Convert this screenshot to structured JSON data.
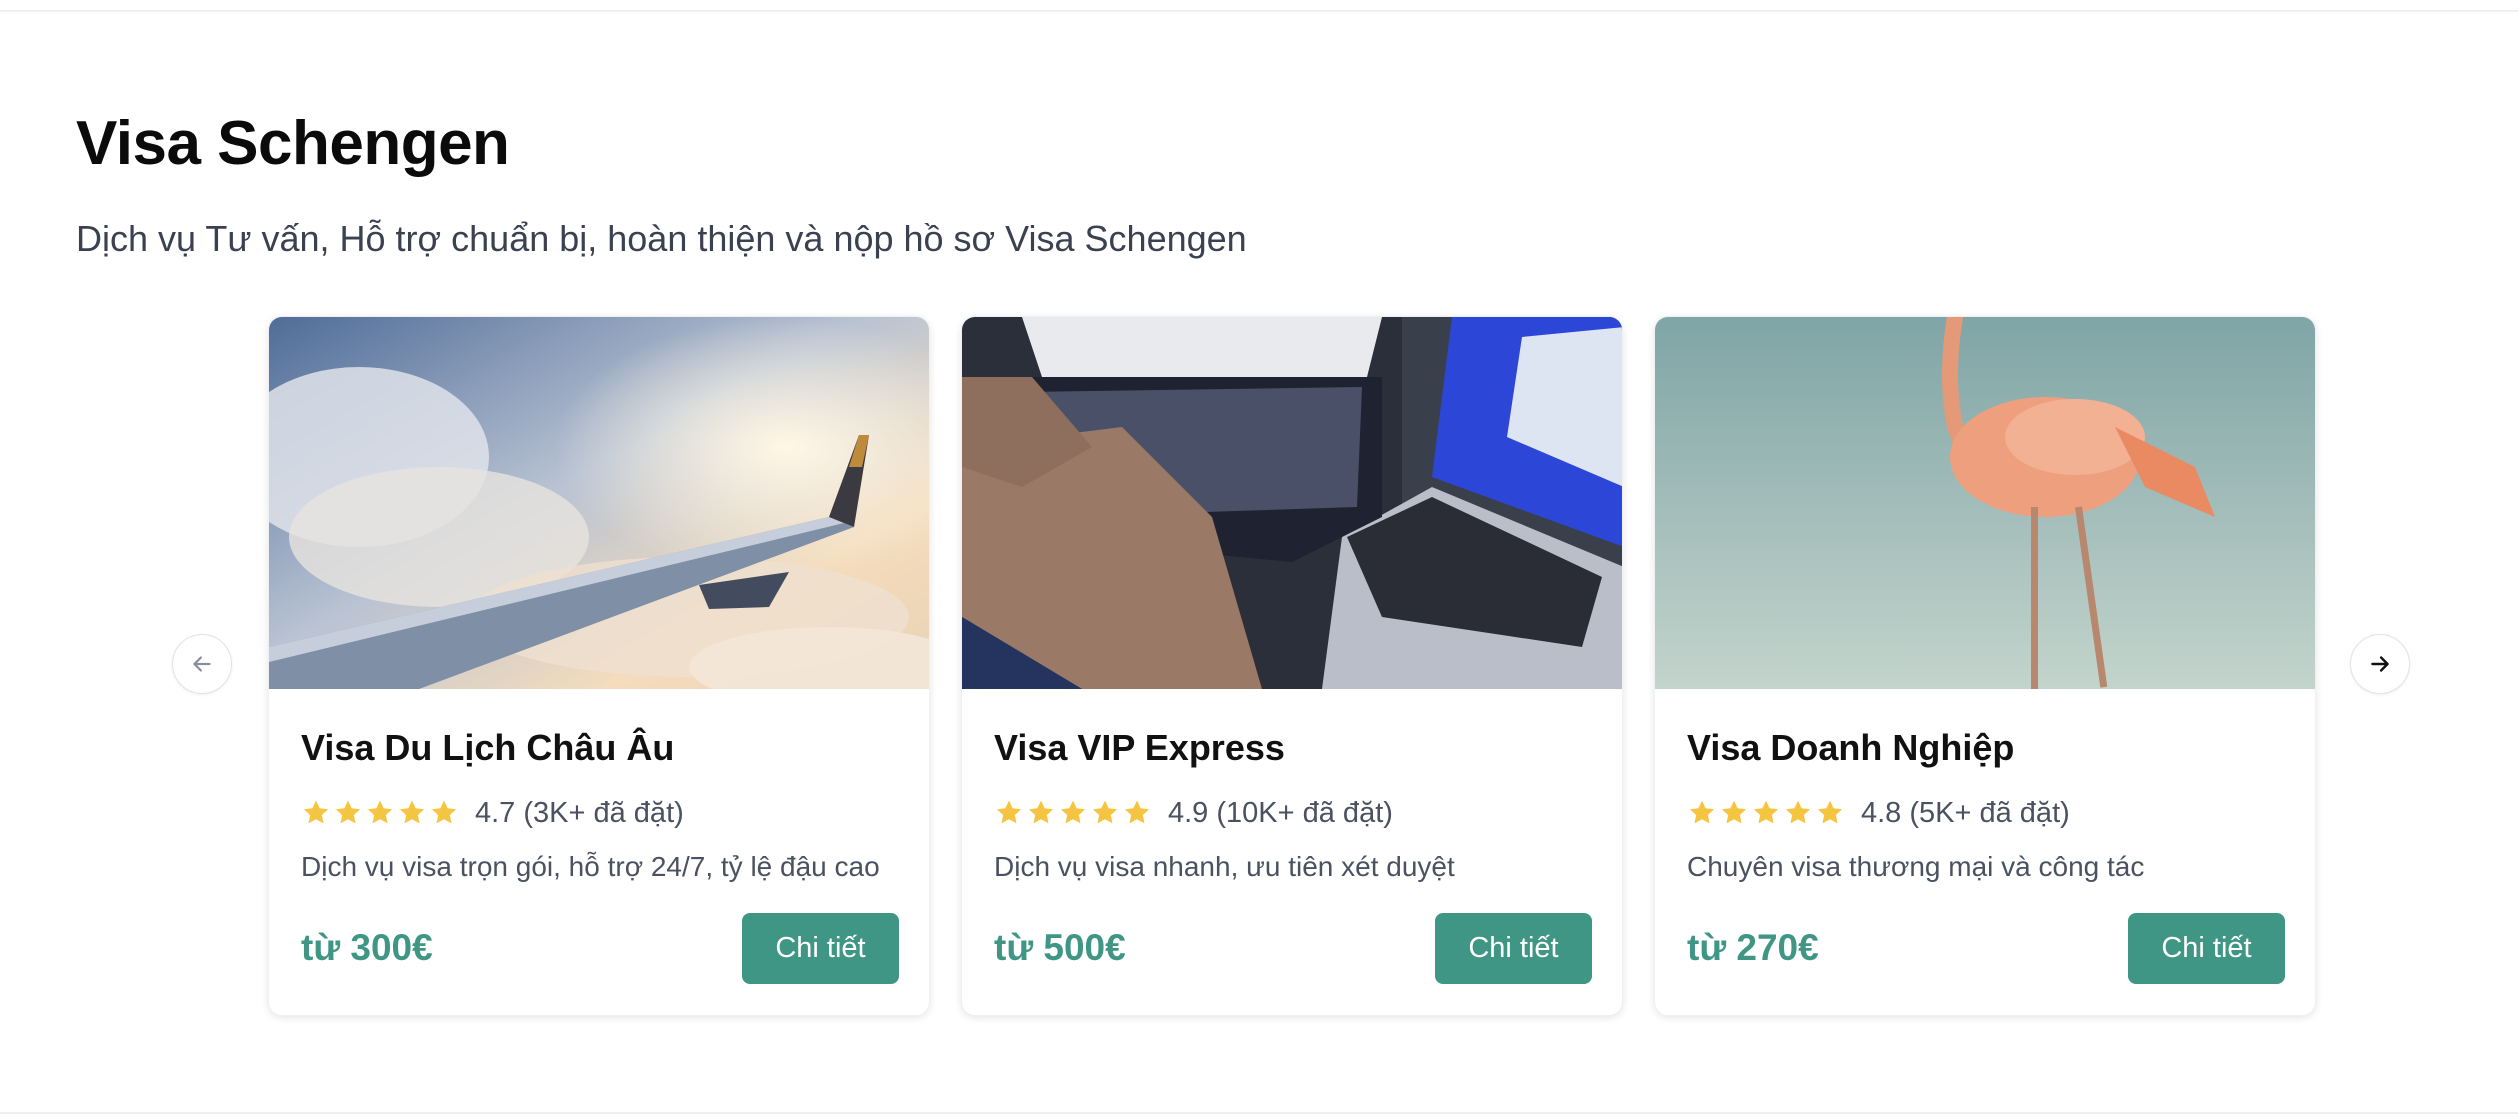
{
  "section": {
    "title": "Visa Schengen",
    "subtitle": "Dịch vụ Tư vấn, Hỗ trợ chuẩn bị, hoàn thiện và nộp hồ sơ Visa Schengen"
  },
  "carousel": {
    "prev_icon": "arrow-left-icon",
    "next_icon": "arrow-right-icon"
  },
  "colors": {
    "accent": "#3f9684",
    "star": "#f5c542",
    "title": "#0b0b0b",
    "muted": "#4a5160"
  },
  "cards": [
    {
      "title": "Visa Du Lịch Châu Âu",
      "stars": 5,
      "rating": "4.7 (3K+ đã đặt)",
      "description": "Dịch vụ visa trọn gói, hỗ trợ 24/7, tỷ lệ đậu cao",
      "price": "từ 300€",
      "button": "Chi tiết"
    },
    {
      "title": "Visa VIP Express",
      "stars": 5,
      "rating": "4.9 (10K+ đã đặt)",
      "description": "Dịch vụ visa nhanh, ưu tiên xét duyệt",
      "price": "từ 500€",
      "button": "Chi tiết"
    },
    {
      "title": "Visa Doanh Nghiệp",
      "stars": 5,
      "rating": "4.8 (5K+ đã đặt)",
      "description": "Chuyên visa thương mại và công tác",
      "price": "từ 270€",
      "button": "Chi tiết"
    }
  ]
}
